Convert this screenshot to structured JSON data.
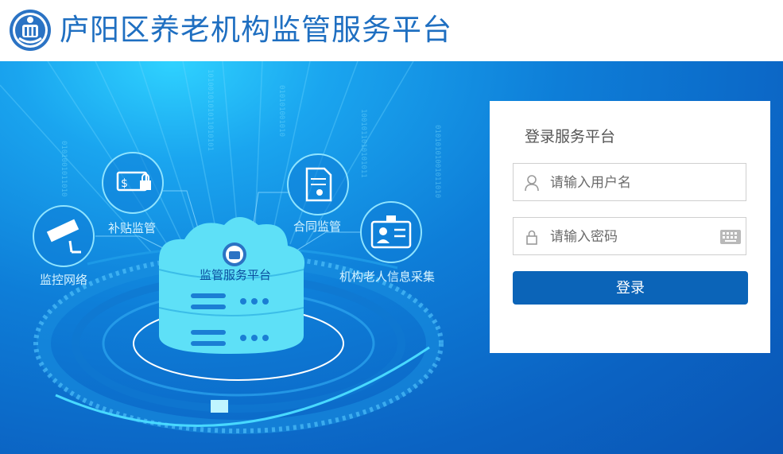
{
  "header": {
    "title": "庐阳区养老机构监管服务平台",
    "logo_icon": "emblem-logo-icon"
  },
  "banner": {
    "center_label": "监管服务平台",
    "nodes": [
      {
        "label": "补贴监管",
        "icon": "subsidy-lock-icon"
      },
      {
        "label": "监控网络",
        "icon": "cctv-camera-icon"
      },
      {
        "label": "合同监管",
        "icon": "contract-document-icon"
      },
      {
        "label": "机构老人信息采集",
        "icon": "id-card-icon"
      }
    ],
    "colors": {
      "deep": "#0a55b4",
      "light": "#2fd2ff",
      "cloud": "#5ee0f7"
    }
  },
  "login": {
    "title": "登录服务平台",
    "username_placeholder": "请输入用户名",
    "password_placeholder": "请输入密码",
    "button_label": "登录",
    "user_icon": "user-icon",
    "lock_icon": "lock-icon",
    "keyboard_icon": "keyboard-icon",
    "accent_color": "#0b64b8"
  }
}
